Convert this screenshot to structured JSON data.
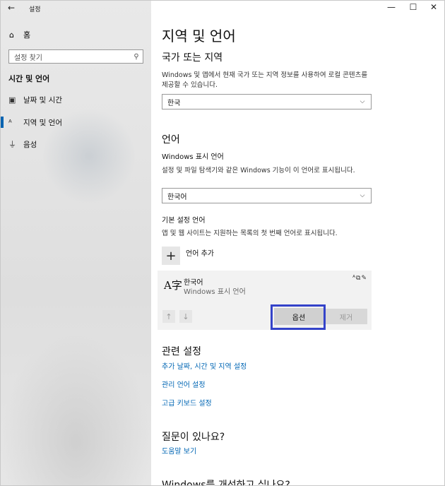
{
  "app": {
    "title": "설정"
  },
  "window_controls": {
    "minimize": "—",
    "maximize": "☐",
    "close": "✕"
  },
  "sidebar": {
    "home_label": "홈",
    "search_placeholder": "설정 찾기",
    "section_heading": "시간 및 언어",
    "items": [
      {
        "label": "날짜 및 시간",
        "icon": "calendar-clock-icon",
        "active": false
      },
      {
        "label": "지역 및 언어",
        "icon": "language-icon",
        "active": true
      },
      {
        "label": "음성",
        "icon": "microphone-icon",
        "active": false
      }
    ]
  },
  "main": {
    "title": "지역 및 언어",
    "region": {
      "heading": "국가 또는 지역",
      "description": "Windows 및 앱에서 현재 국가 또는 지역 정보를 사용하여 로컬 콘텐츠를 제공할 수 있습니다.",
      "selected": "한국"
    },
    "language": {
      "heading": "언어",
      "display_label": "Windows 표시 언어",
      "display_description": "설정 및 파일 탐색기와 같은 Windows 기능이 이 언어로 표시됩니다.",
      "display_selected": "한국어",
      "preferred_label": "기본 설정 언어",
      "preferred_description": "앱 및 웹 사이트는 지원하는 목록의 첫 번째 언어로 표시됩니다.",
      "add_label": "언어 추가",
      "card": {
        "name": "한국어",
        "subtitle": "Windows 표시 언어",
        "options_button": "옵션",
        "remove_button": "제거"
      }
    },
    "related": {
      "heading": "관련 설정",
      "links": [
        "추가 날짜, 시간 및 지역 설정",
        "관리 언어 설정",
        "고급 키보드 설정"
      ]
    },
    "question": {
      "heading": "질문이 있나요?",
      "link": "도움말 보기"
    },
    "improve": {
      "heading": "Windows를 개선하고 싶나요?"
    }
  },
  "colors": {
    "accent": "#0063b1",
    "link": "#0066b4",
    "highlight": "#3443c9"
  }
}
